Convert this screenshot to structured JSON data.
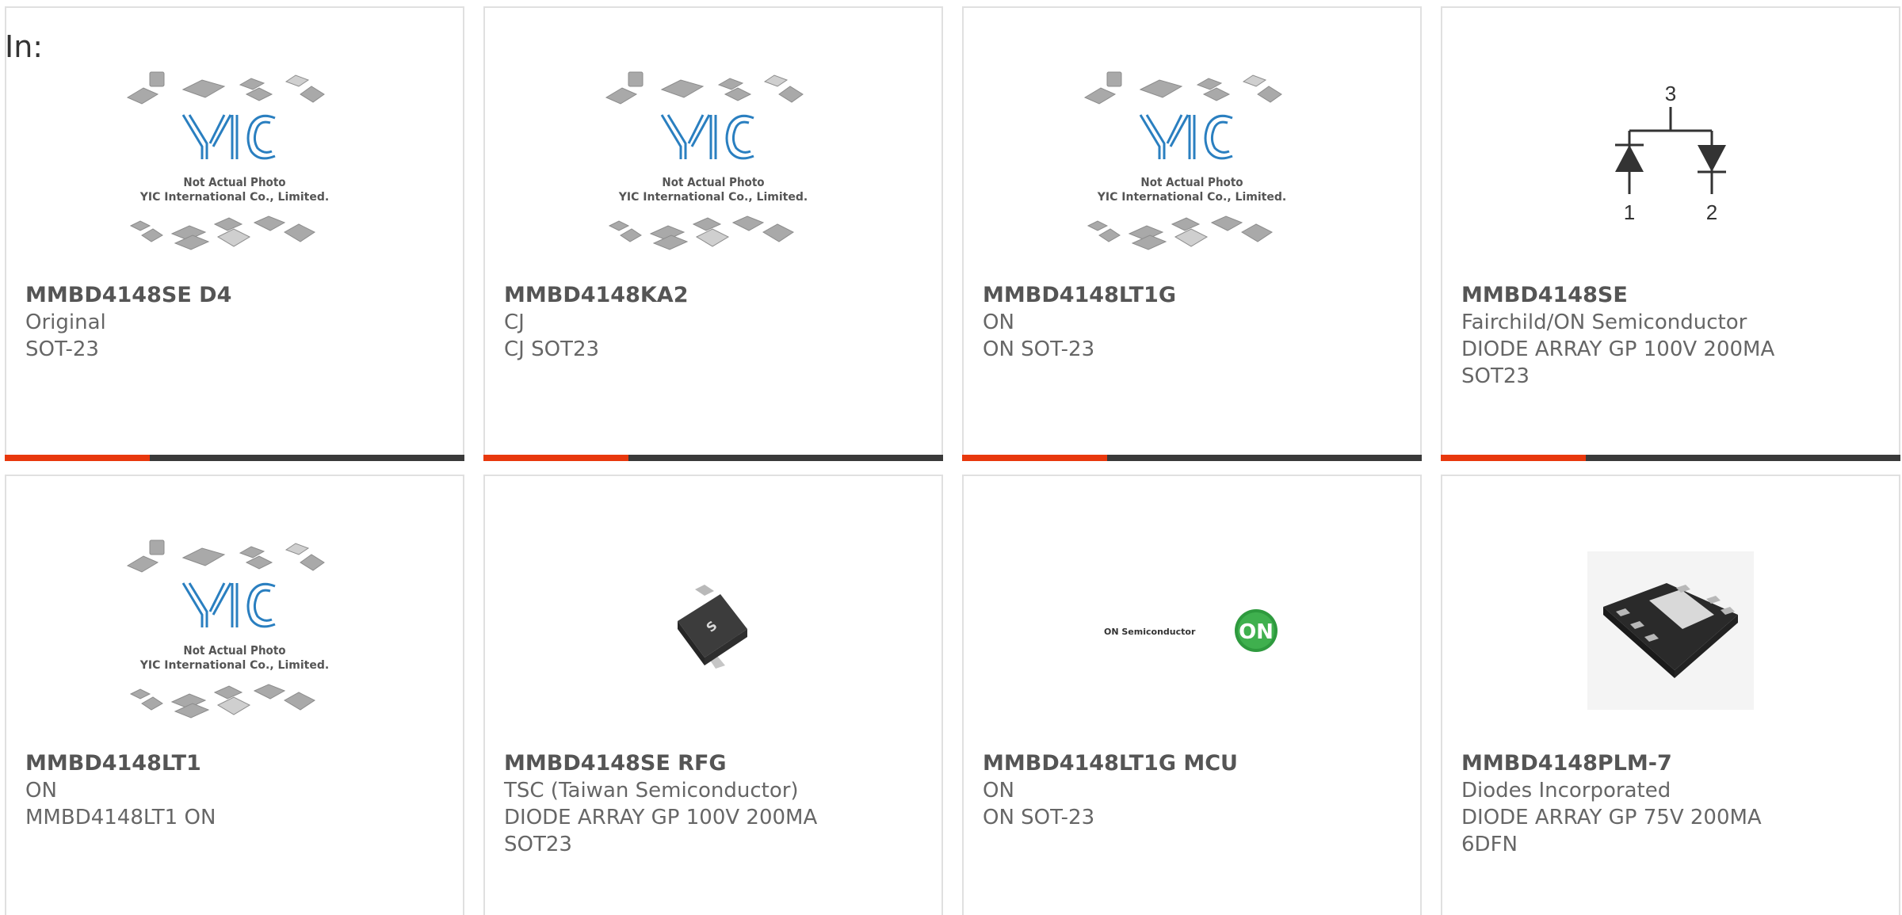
{
  "header": {
    "label": "In:"
  },
  "products": [
    {
      "name": "MMBD4148SE D4",
      "lines": [
        "Original",
        "SOT-23"
      ],
      "image": "yic-placeholder"
    },
    {
      "name": "MMBD4148KA2",
      "lines": [
        "CJ",
        "CJ SOT23"
      ],
      "image": "yic-placeholder"
    },
    {
      "name": "MMBD4148LT1G",
      "lines": [
        "ON",
        "ON SOT-23"
      ],
      "image": "yic-placeholder"
    },
    {
      "name": "MMBD4148SE",
      "lines": [
        "Fairchild/ON Semiconductor",
        "DIODE ARRAY GP 100V 200MA",
        "SOT23"
      ],
      "image": "diode-schematic"
    },
    {
      "name": "MMBD4148LT1",
      "lines": [
        "ON",
        "MMBD4148LT1 ON"
      ],
      "image": "yic-placeholder"
    },
    {
      "name": "MMBD4148SE RFG",
      "lines": [
        "TSC (Taiwan Semiconductor)",
        "DIODE ARRAY GP 100V 200MA",
        "SOT23"
      ],
      "image": "sot23-package"
    },
    {
      "name": "MMBD4148LT1G MCU",
      "lines": [
        "ON",
        "ON SOT-23"
      ],
      "image": "on-semi-logo"
    },
    {
      "name": "MMBD4148PLM-7",
      "lines": [
        "Diodes Incorporated",
        "DIODE ARRAY GP 75V 200MA",
        "6DFN"
      ],
      "image": "dfn-package"
    }
  ],
  "placeholder": {
    "line1": "Not Actual Photo",
    "line2": "YIC International Co., Limited.",
    "logo": "YIC"
  },
  "schematic_pins": [
    "3",
    "1",
    "2"
  ],
  "on_logo": {
    "brand": "ON Semiconductor",
    "mark": "ON"
  },
  "package_mark": "S",
  "colors": {
    "accent": "#e8380d",
    "bar": "#3a3a3a",
    "border": "#e0e0e0"
  }
}
